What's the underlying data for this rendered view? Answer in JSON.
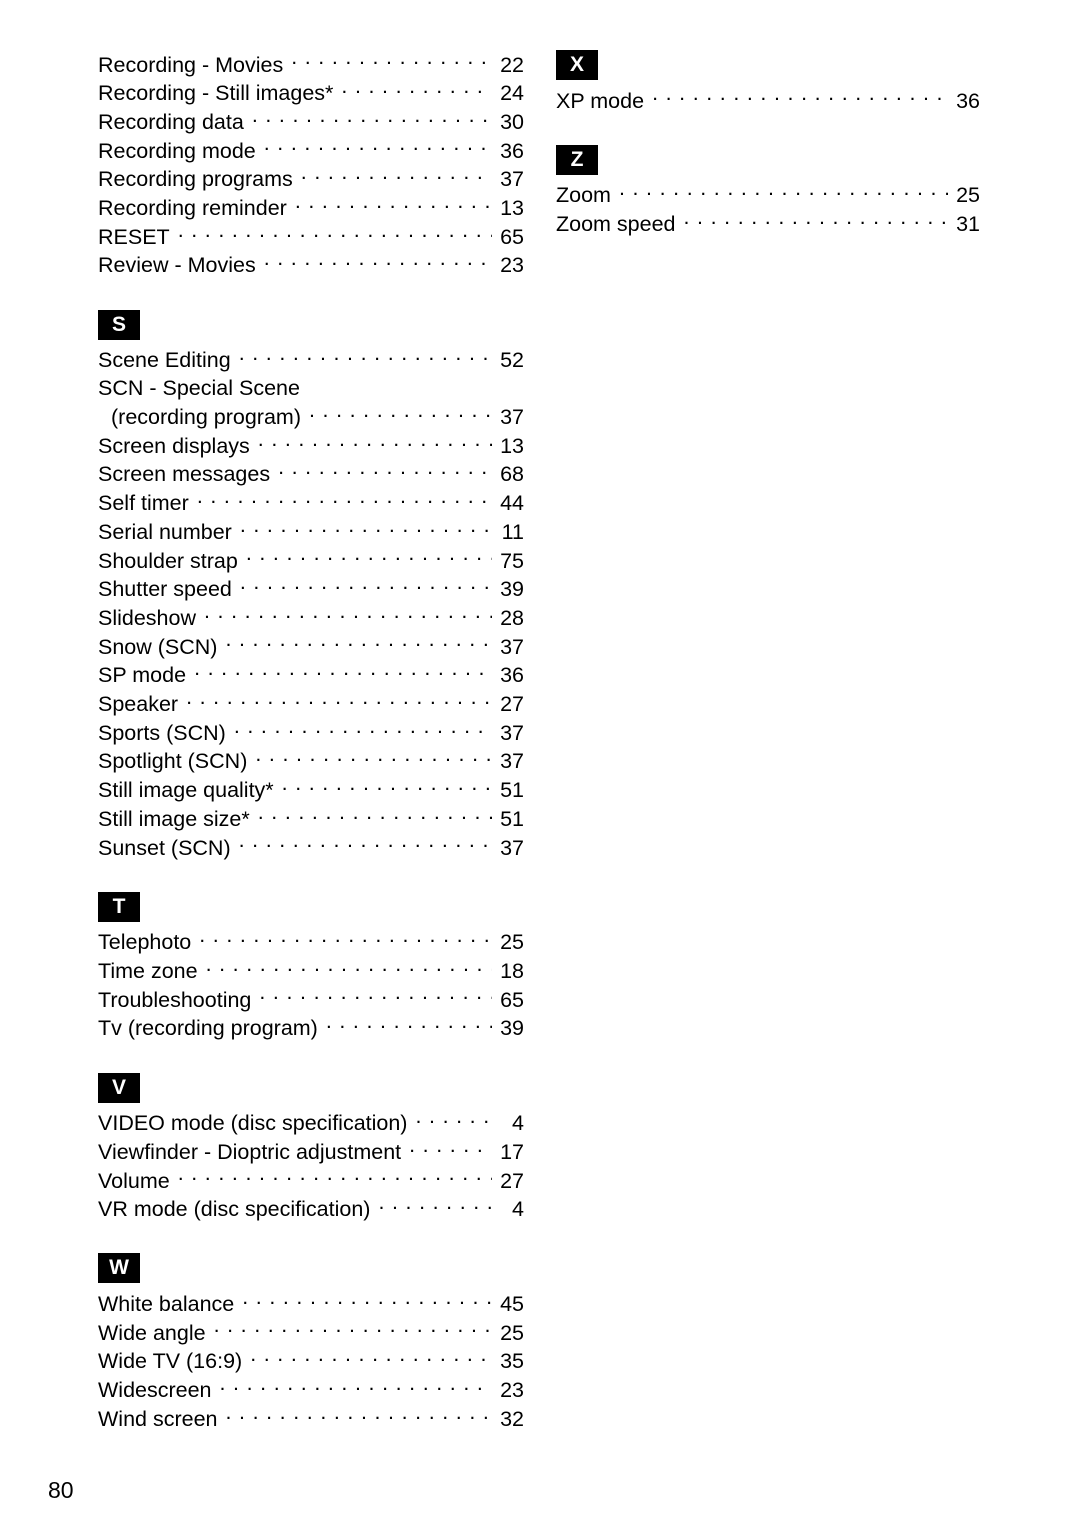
{
  "page": {
    "number": "80",
    "dot_leader": "."
  },
  "columns": [
    {
      "name": "left-column",
      "blocks": [
        {
          "type": "entries",
          "entries": [
            {
              "label": "Recording - Movies",
              "page": "22"
            },
            {
              "label": "Recording - Still images*",
              "page": "24"
            },
            {
              "label": "Recording data",
              "page": "30"
            },
            {
              "label": "Recording mode",
              "page": "36"
            },
            {
              "label": "Recording programs",
              "page": "37"
            },
            {
              "label": "Recording reminder",
              "page": "13"
            },
            {
              "label": "RESET",
              "page": "65"
            },
            {
              "label": "Review - Movies",
              "page": "23"
            }
          ]
        },
        {
          "type": "section",
          "letter": "S",
          "entries": [
            {
              "label": "Scene Editing",
              "page": "52"
            },
            {
              "label": "SCN - Special Scene",
              "page": "",
              "continues": true
            },
            {
              "label": "(recording program)",
              "page": "37",
              "indent": true
            },
            {
              "label": "Screen displays",
              "page": "13"
            },
            {
              "label": "Screen messages",
              "page": "68"
            },
            {
              "label": "Self timer",
              "page": "44"
            },
            {
              "label": "Serial number",
              "page": "11"
            },
            {
              "label": "Shoulder strap",
              "page": "75"
            },
            {
              "label": "Shutter speed",
              "page": "39"
            },
            {
              "label": "Slideshow",
              "page": "28"
            },
            {
              "label": "Snow (SCN)",
              "page": "37"
            },
            {
              "label": "SP mode",
              "page": "36"
            },
            {
              "label": "Speaker",
              "page": "27"
            },
            {
              "label": "Sports (SCN)",
              "page": "37"
            },
            {
              "label": "Spotlight (SCN)",
              "page": "37"
            },
            {
              "label": "Still image quality*",
              "page": "51"
            },
            {
              "label": "Still image size*",
              "page": "51"
            },
            {
              "label": "Sunset (SCN)",
              "page": "37"
            }
          ]
        },
        {
          "type": "section",
          "letter": "T",
          "entries": [
            {
              "label": "Telephoto",
              "page": "25"
            },
            {
              "label": "Time zone",
              "page": "18"
            },
            {
              "label": "Troubleshooting",
              "page": "65"
            },
            {
              "label": "Tv (recording program)",
              "page": "39"
            }
          ]
        },
        {
          "type": "section",
          "letter": "V",
          "entries": [
            {
              "label": "VIDEO mode (disc specification)",
              "page": "4"
            },
            {
              "label": "Viewfinder - Dioptric adjustment",
              "page": "17"
            },
            {
              "label": "Volume",
              "page": "27"
            },
            {
              "label": "VR mode (disc specification)",
              "page": "4"
            }
          ]
        },
        {
          "type": "section",
          "letter": "W",
          "entries": [
            {
              "label": "White balance",
              "page": "45"
            },
            {
              "label": "Wide angle",
              "page": "25"
            },
            {
              "label": "Wide TV (16:9)",
              "page": "35"
            },
            {
              "label": "Widescreen",
              "page": "23"
            },
            {
              "label": "Wind screen",
              "page": "32"
            }
          ]
        }
      ]
    },
    {
      "name": "right-column",
      "blocks": [
        {
          "type": "section",
          "letter": "X",
          "first": true,
          "entries": [
            {
              "label": "XP mode",
              "page": "36"
            }
          ]
        },
        {
          "type": "section",
          "letter": "Z",
          "entries": [
            {
              "label": "Zoom",
              "page": "25"
            },
            {
              "label": "Zoom speed",
              "page": "31"
            }
          ]
        }
      ]
    }
  ]
}
